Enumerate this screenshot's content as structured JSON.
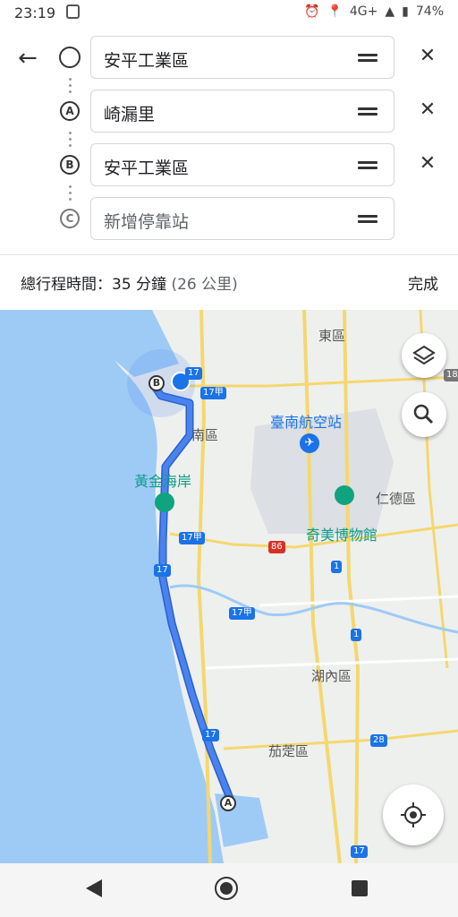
{
  "status_bar": {
    "time": "23:19",
    "network": "4G+",
    "battery": "74%"
  },
  "route": {
    "origin": {
      "value": "安平工業區",
      "marker": ""
    },
    "stops": [
      {
        "marker": "A",
        "value": "崎漏里"
      },
      {
        "marker": "B",
        "value": "安平工業區"
      }
    ],
    "add_stop": {
      "marker": "C",
      "placeholder": "新增停靠站"
    }
  },
  "summary": {
    "label": "總行程時間：35 分鐘",
    "distance": "(26 公里)",
    "done": "完成"
  },
  "map": {
    "labels": {
      "east": "東區",
      "south": "南區",
      "airport": "臺南航空站",
      "beach": "黃金海岸",
      "rende": "仁德區",
      "museum": "奇美博物館",
      "hunei": "湖內區",
      "qieding": "茄萣區"
    },
    "roads": [
      "17",
      "17甲",
      "86",
      "1",
      "28",
      "18"
    ],
    "markers": {
      "a": "A",
      "b": "B"
    },
    "colors": {
      "water": "#9ecbf6",
      "land": "#eef0ee",
      "route": "#4a83f0",
      "route_outline": "#2b5fc7"
    }
  }
}
